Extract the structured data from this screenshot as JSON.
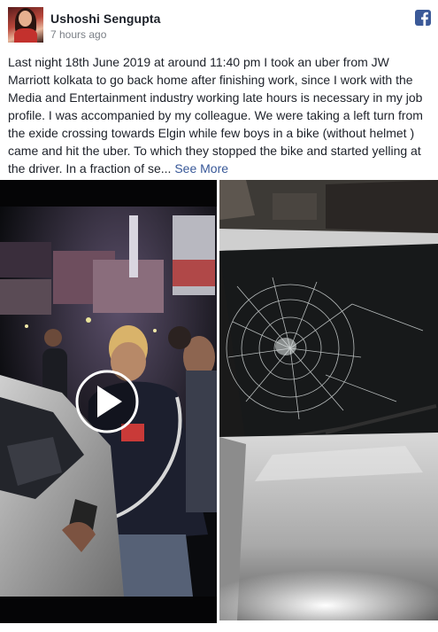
{
  "post": {
    "author": "Ushoshi Sengupta",
    "timestamp": "7 hours ago",
    "body": "Last night 18th June 2019 at around 11:40 pm I took an uber from JW Marriott kolkata to go back home after finishing work, since I work with the Media and Entertainment industry working late hours is necessary in my job profile. I was accompanied by my colleague. We were taking a left turn from the exide crossing towards Elgin while few boys in a bike (without helmet ) came and hit the uber. To which they stopped the bike and started yelling at the driver. In a fraction of se...",
    "see_more": "See More"
  },
  "icons": {
    "platform": "facebook-icon",
    "video_control": "play-icon"
  },
  "colors": {
    "facebook_blue": "#3b5998",
    "link_blue": "#385898",
    "text": "#1d2129",
    "meta": "#7a7f86"
  }
}
